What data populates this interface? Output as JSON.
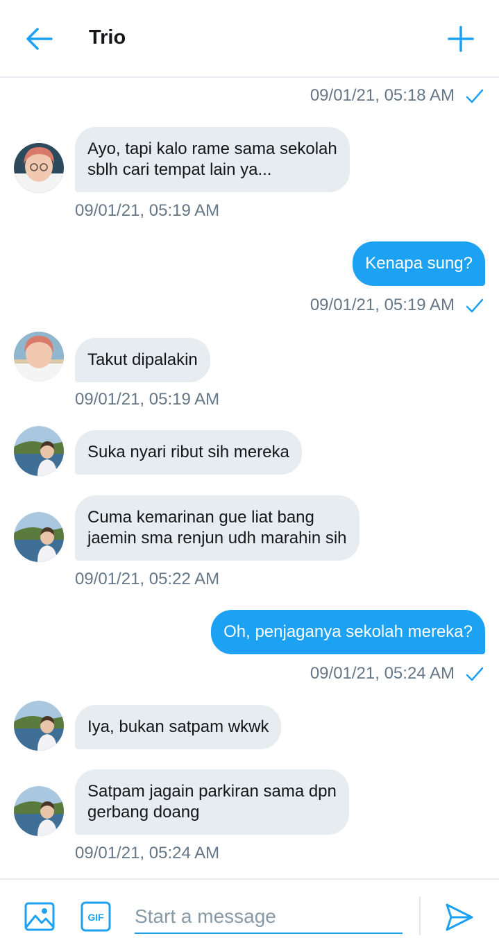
{
  "header": {
    "back_icon": "arrow-left-icon",
    "title": "Trio",
    "new_icon": "plus-icon",
    "accent": "#1da1f2"
  },
  "messages": [
    {
      "from": "me",
      "timestamp": "09/01/21, 05:18 AM",
      "status_icon": "check-icon"
    },
    {
      "from": "other",
      "avatar": "avatar-pink-hair",
      "lines": [
        "Ayo, tapi kalo rame sama sekolah",
        "sblh cari tempat lain ya..."
      ],
      "timestamp": "09/01/21, 05:19 AM"
    },
    {
      "from": "me",
      "text": "Kenapa sung?",
      "timestamp": "09/01/21, 05:19 AM",
      "status_icon": "check-icon"
    },
    {
      "from": "other",
      "avatar": "avatar-pink-hair",
      "text": "Takut dipalakin",
      "timestamp": "09/01/21, 05:19 AM"
    },
    {
      "from": "other",
      "avatar": "avatar-beach",
      "text": "Suka nyari ribut sih mereka"
    },
    {
      "from": "other",
      "avatar": "avatar-beach",
      "lines": [
        "Cuma kemarinan gue liat bang",
        "jaemin sma renjun udh marahin sih"
      ],
      "timestamp": "09/01/21, 05:22 AM"
    },
    {
      "from": "me",
      "text": "Oh, penjaganya sekolah mereka?",
      "timestamp": "09/01/21, 05:24 AM",
      "status_icon": "check-icon"
    },
    {
      "from": "other",
      "avatar": "avatar-beach",
      "text": "Iya, bukan satpam wkwk"
    },
    {
      "from": "other",
      "avatar": "avatar-beach",
      "lines": [
        "Satpam jagain parkiran sama dpn",
        "gerbang doang"
      ],
      "timestamp": "09/01/21, 05:24 AM"
    }
  ],
  "composer": {
    "media_icon": "image-icon",
    "gif_label": "GIF",
    "placeholder": "Start a message",
    "send_icon": "send-icon"
  },
  "colors": {
    "outgoing_bubble": "#1da1f2",
    "incoming_bubble": "#e6ecf0",
    "timestamp": "#657786"
  }
}
